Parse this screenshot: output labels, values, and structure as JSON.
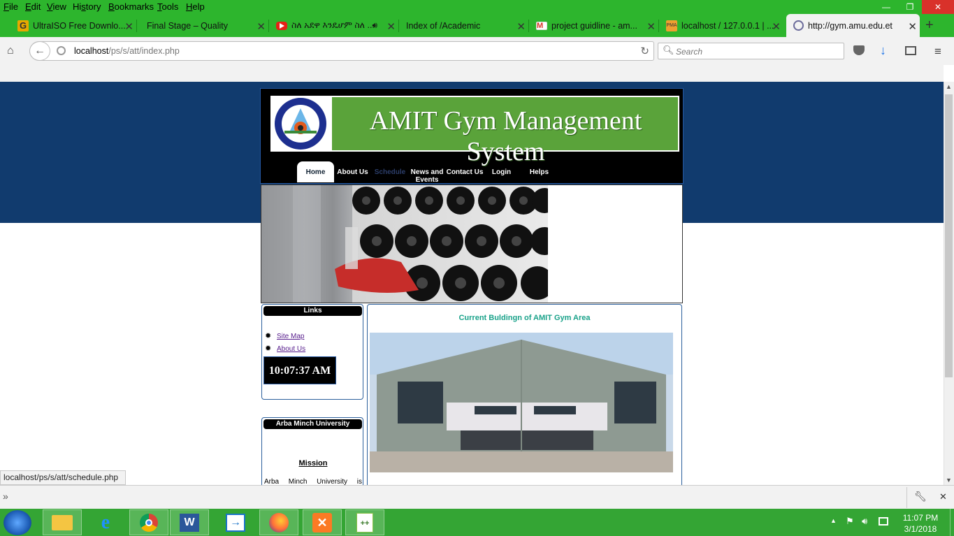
{
  "menubar": {
    "items": [
      "File",
      "Edit",
      "View",
      "History",
      "Bookmarks",
      "Tools",
      "Help"
    ],
    "access_keys": [
      "F",
      "E",
      "V",
      "s",
      "B",
      "T",
      "H"
    ]
  },
  "tabs": [
    {
      "title": "UltraISO Free Downlo...",
      "icon": "ultraiso-icon",
      "color": "#e8a800"
    },
    {
      "title": "Final Stage – Quality",
      "icon": "blank-page-icon",
      "color": ""
    },
    {
      "title": "ስለ አደዋ እንዴሆም ስለ ...",
      "icon": "youtube-icon",
      "color": "#e62117"
    },
    {
      "title": "Index of /Academic",
      "icon": "blank-page-icon",
      "color": ""
    },
    {
      "title": "project guidline - am...",
      "icon": "gmail-icon",
      "color": "#d93025"
    },
    {
      "title": "localhost / 127.0.0.1 | ...",
      "icon": "phpmyadmin-icon",
      "color": "#f0a030"
    },
    {
      "title": "http://gym.amu.edu.et",
      "icon": "globe-icon",
      "color": "#6a6a9a",
      "active": true
    }
  ],
  "navbar": {
    "url_host": "localhost",
    "url_path": "/ps/s/att/index.php",
    "search_placeholder": "Search"
  },
  "site": {
    "title": "AMIT Gym Management System",
    "logo_text": "ARBA MINCH UNIVERSITY",
    "nav": [
      "Home",
      "About Us",
      "Schedule",
      "News and Events",
      "Contact Us",
      "Login",
      "Helps"
    ],
    "nav_active": "Home",
    "sidebar_links_heading": "Links",
    "links": [
      "Site Map",
      "About Us"
    ],
    "clock": "10:07:37 AM",
    "sidebar2_heading": "Arba Minch University",
    "mission_heading": "Mission",
    "mission_text_start": [
      "Arba",
      "Minch",
      "University",
      "is"
    ],
    "main_heading": "Current Buldingn of AMIT Gym Area"
  },
  "statusbar": {
    "hover_url": "localhost/ps/s/att/schedule.php"
  },
  "taskbar": {
    "apps": [
      "start-orb",
      "file-explorer-icon",
      "internet-explorer-icon",
      "chrome-icon",
      "word-icon",
      "remote-app-icon",
      "firefox-icon",
      "xampp-icon",
      "notepad-plus-icon"
    ],
    "time": "11:07 PM",
    "date": "3/1/2018"
  },
  "colors": {
    "chrome_green": "#2db52d",
    "page_blue": "#113b6e",
    "site_green": "#5aa33a",
    "heading_teal": "#1aa28a",
    "link_purple": "#551a8b"
  }
}
